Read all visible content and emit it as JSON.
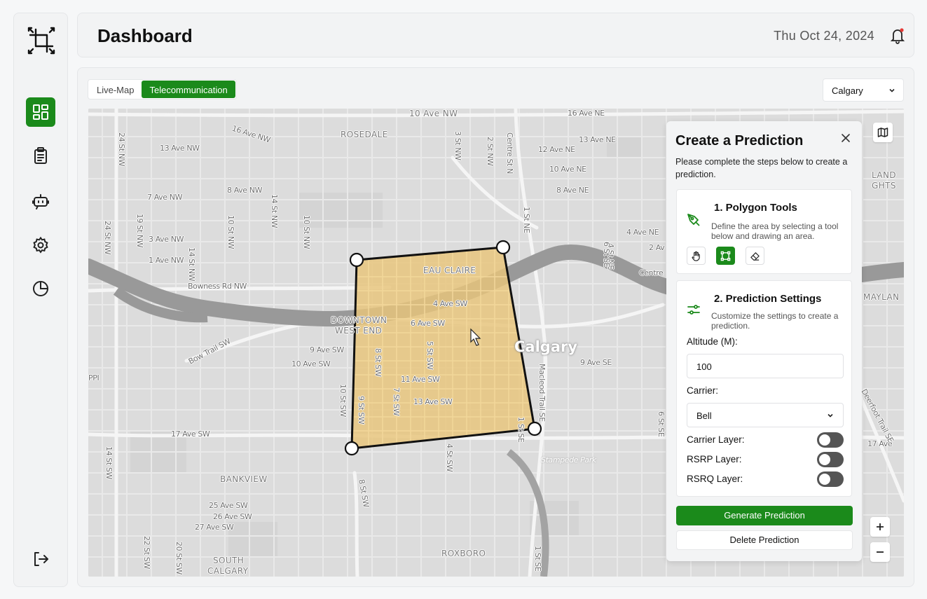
{
  "header": {
    "title": "Dashboard",
    "date": "Thu Oct 24, 2024"
  },
  "sidebar": {
    "items": [
      {
        "icon": "dashboard-icon",
        "active": true
      },
      {
        "icon": "clipboard-icon",
        "active": false
      },
      {
        "icon": "bot-icon",
        "active": false
      },
      {
        "icon": "gear-icon",
        "active": false
      },
      {
        "icon": "pie-chart-icon",
        "active": false
      }
    ],
    "logout_icon": "logout-icon"
  },
  "tabs": [
    {
      "label": "Live-Map",
      "active": false
    },
    {
      "label": "Telecommunication",
      "active": true
    }
  ],
  "city_select": {
    "value": "Calgary"
  },
  "map": {
    "labels": {
      "ave16nw": "16 Ave NW",
      "rosedale": "ROSEDALE",
      "ave13nw": "13 Ave NW",
      "ave7nw": "7 Ave NW",
      "ave8nw": "8 Ave NW",
      "ave3nw": "3 Ave NW",
      "ave1nw": "1 Ave NW",
      "bowness": "Bowness Rd NW",
      "ave12ne": "12 Ave NE",
      "ave13ne": "13 Ave NE",
      "ave10ne": "10 Ave NE",
      "ave8ne": "8 Ave NE",
      "ave4ne": "4 Ave NE",
      "ave2": "2 Av",
      "centre": "Centre",
      "eauclaire": "EAU CLAIRE",
      "ave4sw": "4 Ave SW",
      "ave6sw": "6 Ave SW",
      "downtown1": "DOWNTOWN",
      "downtown2": "WEST END",
      "bowtrail": "Bow Trail SW",
      "ave9sw": "9 Ave SW",
      "ave10sw": "10 Ave SW",
      "ave11sw": "11 Ave SW",
      "ave13sw": "13 Ave SW",
      "calgary": "Calgary",
      "ave9se": "9 Ave SE",
      "ave17sw": "17 Ave SW",
      "bankview": "BANKVIEW",
      "ave25sw": "25 Ave SW",
      "ave26sw": "26 Ave SW",
      "ave27sw": "27 Ave SW",
      "south1": "SOUTH",
      "south2": "CALGARY",
      "roxboro": "ROXBORO",
      "stampede": "Stampede Park",
      "maylan": "MAYLAN",
      "land": "LAND",
      "ghts": "GHTS",
      "ave17e": "17 Ave",
      "centrest": "Centre St N",
      "st1ne": "1 St NE",
      "st4ne": "4 St NE",
      "st10nw": "10 St NW",
      "st14nw": "14 St NW",
      "st19nw": "19 St NW",
      "st24nw": "24 St NW",
      "st3nw": "3 St NW",
      "st2nw": "2 St NW",
      "st8sw": "8 St SW",
      "st5sw": "5 St SW",
      "st7sw": "7 St SW",
      "st9sw": "9 St SW",
      "st10sw": "10 St SW",
      "st14sw": "14 St SW",
      "st22sw": "22 St SW",
      "st20sw": "20 St SW",
      "st4sw": "4 St SW",
      "st8sw2": "8 St SW",
      "st1se": "1 St SE",
      "macleod": "Macleod Trail SE",
      "st6se": "6 St SE",
      "deerfoot": "Deerfoot Trail SE",
      "ppi": "PPI",
      "ave10nw": "10 Ave NW",
      "ave16ne": "16 Ave NE",
      "ave10nw2": "10 Ave NE"
    }
  },
  "prediction": {
    "title": "Create a Prediction",
    "subtitle": "Please complete the steps below to create a prediction.",
    "step1": {
      "title": "1. Polygon Tools",
      "description": "Define the area by selecting a tool below and drawing an area.",
      "tools": [
        "hand-icon",
        "polygon-icon",
        "eraser-icon"
      ]
    },
    "step2": {
      "title": "2. Prediction Settings",
      "description": "Customize the settings to create a prediction.",
      "altitude_label": "Altitude (M):",
      "altitude_value": "100",
      "carrier_label": "Carrier:",
      "carrier_value": "Bell",
      "carrier_layer_label": "Carrier Layer:",
      "rsrp_layer_label": "RSRP Layer:",
      "rsrq_layer_label": "RSRQ Layer:",
      "carrier_layer_on": false,
      "rsrp_layer_on": false,
      "rsrq_layer_on": false
    },
    "generate_label": "Generate Prediction",
    "delete_label": "Delete Prediction"
  },
  "colors": {
    "accent": "#1b8a1b",
    "polygon_fill": "#e8c57a",
    "map_bg": "#dedede",
    "river": "#9a9a9a"
  }
}
